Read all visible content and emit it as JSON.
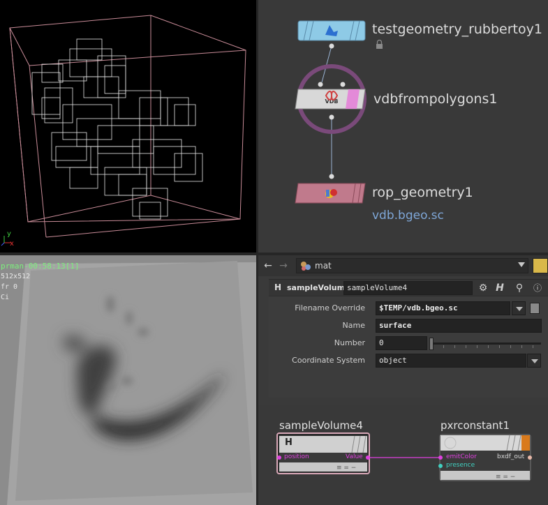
{
  "viewport": {
    "axis_labels": {
      "y": "y",
      "x": "x"
    }
  },
  "network": {
    "nodes": [
      {
        "name": "testgeometry_rubbertoy1",
        "color": "#8ecae6"
      },
      {
        "name": "vdbfrompolygons1",
        "color": "#d8d8d8"
      },
      {
        "name": "rop_geometry1",
        "color": "#c07a8c"
      }
    ],
    "output_file": "vdb.bgeo.sc"
  },
  "render_view": {
    "title": "prman-00:58:13[1]",
    "resolution": "512x512",
    "frame": "fr 0",
    "channel": "Ci"
  },
  "path_bar": {
    "back_icon": "arrow-left-icon",
    "forward_icon": "arrow-right-icon",
    "path": "mat"
  },
  "parameters": {
    "node_type_icon": "H",
    "node_type": "sampleVolume",
    "node_name": "sampleVolume4",
    "header_icon_letter": "H",
    "fields": {
      "filename_override": {
        "label": "Filename Override",
        "value": "$TEMP/vdb.bgeo.sc"
      },
      "name": {
        "label": "Name",
        "value": "surface"
      },
      "number": {
        "label": "Number",
        "value": "0"
      },
      "coordinate_system": {
        "label": "Coordinate System",
        "value": "object"
      }
    }
  },
  "vop_network": {
    "node_a": {
      "title": "sampleVolume4",
      "icon": "H",
      "input": "position",
      "output": "Value"
    },
    "node_b": {
      "title": "pxrconstant1",
      "inputs": [
        "emitColor",
        "presence"
      ],
      "output": "bxdf_out",
      "accent": "#d97a1c"
    },
    "wire_color": "#e040e0"
  }
}
